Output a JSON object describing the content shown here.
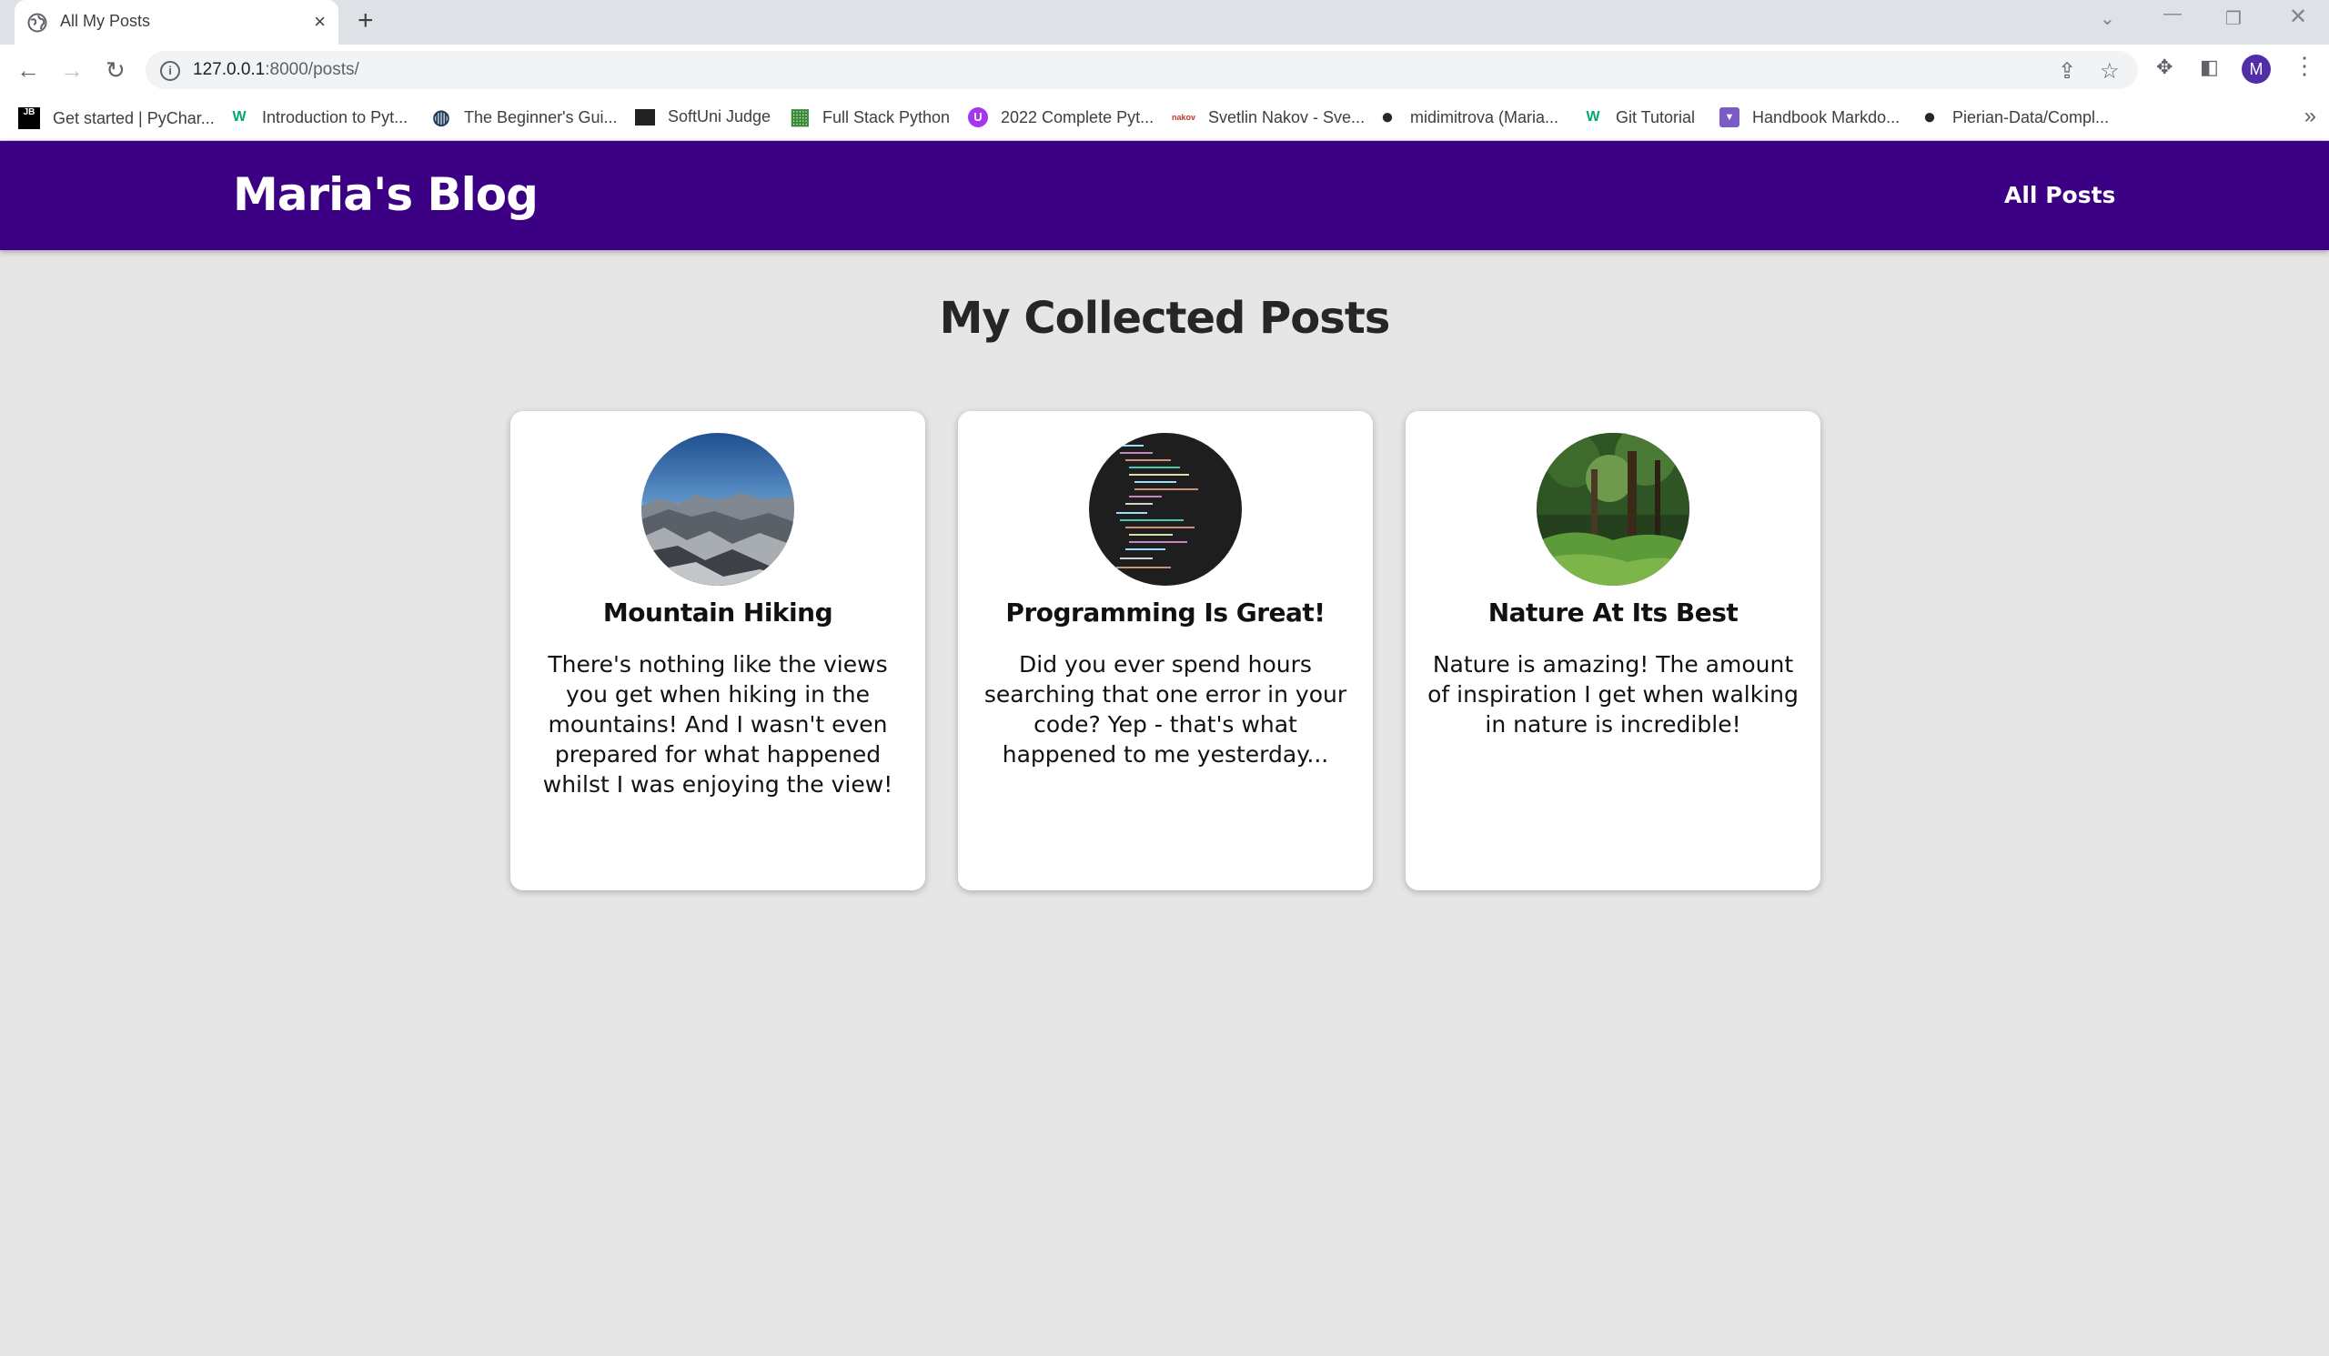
{
  "browser": {
    "tab_title": "All My Posts",
    "tab_close": "×",
    "new_tab": "+",
    "url_host": "127.0.0.1",
    "url_path": ":8000/posts/",
    "profile_initial": "M",
    "bookmarks": [
      {
        "label": "Get started | PyChar...",
        "icon": "jetbrains-icon",
        "glyph": "JB",
        "color": "#000000"
      },
      {
        "label": "Introduction to Pyt...",
        "icon": "w3-icon",
        "glyph": "W",
        "color": "#04aa6d"
      },
      {
        "label": "The Beginner's Gui...",
        "icon": "globe-icon",
        "glyph": "◍",
        "color": "#1f3a56"
      },
      {
        "label": "SoftUni Judge",
        "icon": "softuni-icon",
        "glyph": "▬",
        "color": "#222222"
      },
      {
        "label": "Full Stack Python",
        "icon": "grid-icon",
        "glyph": "▦",
        "color": "#3a8a3a"
      },
      {
        "label": "2022 Complete Pyt...",
        "icon": "udemy-icon",
        "glyph": "U",
        "color": "#a435f0"
      },
      {
        "label": "Svetlin Nakov - Sve...",
        "icon": "nakov-icon",
        "glyph": "nakov",
        "color": "#c0392b"
      },
      {
        "label": "midimitrova (Maria...",
        "icon": "github-icon",
        "glyph": "●",
        "color": "#24292f"
      },
      {
        "label": "Git Tutorial",
        "icon": "w3-icon",
        "glyph": "W",
        "color": "#04aa6d"
      },
      {
        "label": "Handbook Markdo...",
        "icon": "markdown-icon",
        "glyph": "▼",
        "color": "#7b5cc7"
      },
      {
        "label": "Pierian-Data/Compl...",
        "icon": "github-icon",
        "glyph": "●",
        "color": "#24292f"
      }
    ],
    "bookmarks_more": "»"
  },
  "site": {
    "brand": "Maria's Blog",
    "nav_all_posts": "All Posts",
    "accent_color": "#3b0083"
  },
  "main": {
    "heading": "My Collected Posts",
    "posts": [
      {
        "title": "Mountain Hiking",
        "excerpt": "There's nothing like the views you get when hiking in the mountains! And I wasn't even prepared for what happened whilst I was enjoying the view!",
        "image": "mountains"
      },
      {
        "title": "Programming Is Great!",
        "excerpt": "Did you ever spend hours searching that one error in your code? Yep - that's what happened to me yesterday...",
        "image": "code"
      },
      {
        "title": "Nature At Its Best",
        "excerpt": "Nature is amazing! The amount of inspiration I get when walking in nature is incredible!",
        "image": "forest"
      }
    ]
  }
}
